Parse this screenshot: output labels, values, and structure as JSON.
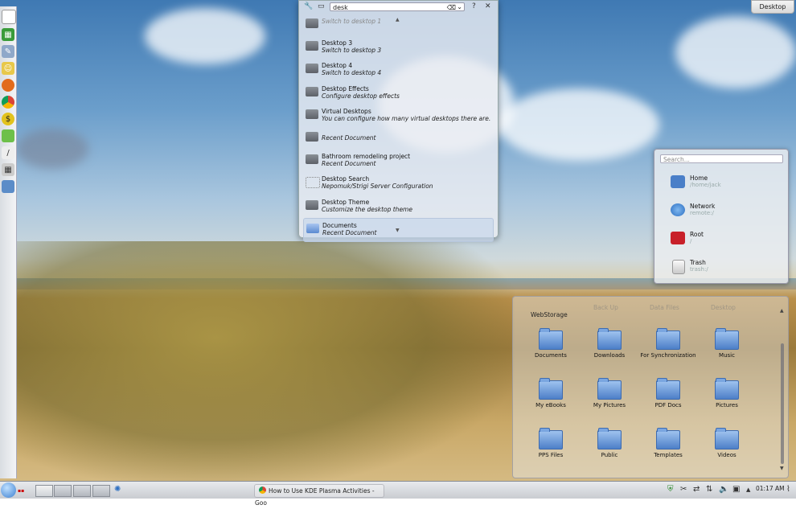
{
  "desktop_button": "Desktop",
  "krunner": {
    "query": "desk",
    "items": [
      {
        "title": "",
        "subtitle": "Switch to desktop 1",
        "icon": "desktop-icon",
        "faded": true
      },
      {
        "title": "Desktop 3",
        "subtitle": "Switch to desktop 3",
        "icon": "desktop-icon"
      },
      {
        "title": "Desktop 4",
        "subtitle": "Switch to desktop 4",
        "icon": "desktop-icon"
      },
      {
        "title": "Desktop Effects",
        "subtitle": "Configure desktop effects",
        "icon": "effects-icon"
      },
      {
        "title": "Virtual Desktops",
        "subtitle": "You can configure how many virtual desktops there are.",
        "icon": "virtual-desktops-icon"
      },
      {
        "title": "",
        "subtitle": "Recent Document",
        "icon": "document-icon"
      },
      {
        "title": "Bathroom remodeling project",
        "subtitle": "Recent Document",
        "icon": "document-icon"
      },
      {
        "title": "Desktop Search",
        "subtitle": "Nepomuk/Strigi Server Configuration",
        "icon": "search-icon"
      },
      {
        "title": "Desktop Theme",
        "subtitle": "Customize the desktop theme",
        "icon": "theme-icon"
      },
      {
        "title": "Documents",
        "subtitle": "Recent Document",
        "icon": "folder-icon",
        "selected": true
      }
    ]
  },
  "places": {
    "search_placeholder": "Search...",
    "items": [
      {
        "title": "Home",
        "path": "/home/jack",
        "icon": "home-folder-icon",
        "color": "#4a7fc8"
      },
      {
        "title": "Network",
        "path": "remote:/",
        "icon": "globe-icon",
        "color": "#2d6fc2"
      },
      {
        "title": "Root",
        "path": "/",
        "icon": "root-folder-icon",
        "color": "#c8202a"
      },
      {
        "title": "Trash",
        "path": "trash:/",
        "icon": "trash-icon",
        "color": "#d9d9d9"
      }
    ]
  },
  "folderview": {
    "tabs": [
      "WebStorage",
      "Back Up",
      "Data Files",
      "Desktop"
    ],
    "items": [
      "Documents",
      "Downloads",
      "For Synchronization",
      "Music",
      "My eBooks",
      "My Pictures",
      "PDF Docs",
      "Pictures",
      "PPS Files",
      "Public",
      "Templates",
      "Videos"
    ]
  },
  "taskbar": {
    "task_title": "How to Use KDE Plasma Activities - Goo",
    "clock": "01:17 AM"
  }
}
